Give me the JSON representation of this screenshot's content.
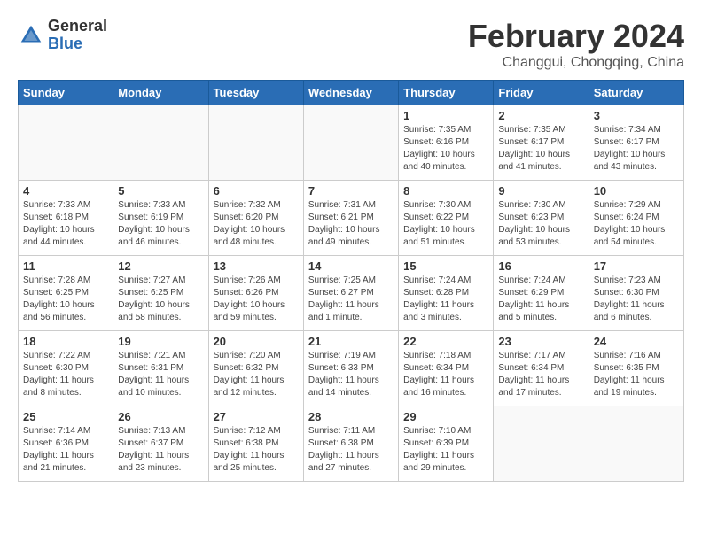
{
  "header": {
    "logo_general": "General",
    "logo_blue": "Blue",
    "title": "February 2024",
    "subtitle": "Changgui, Chongqing, China"
  },
  "days_of_week": [
    "Sunday",
    "Monday",
    "Tuesday",
    "Wednesday",
    "Thursday",
    "Friday",
    "Saturday"
  ],
  "weeks": [
    [
      {
        "day": "",
        "detail": ""
      },
      {
        "day": "",
        "detail": ""
      },
      {
        "day": "",
        "detail": ""
      },
      {
        "day": "",
        "detail": ""
      },
      {
        "day": "1",
        "detail": "Sunrise: 7:35 AM\nSunset: 6:16 PM\nDaylight: 10 hours\nand 40 minutes."
      },
      {
        "day": "2",
        "detail": "Sunrise: 7:35 AM\nSunset: 6:17 PM\nDaylight: 10 hours\nand 41 minutes."
      },
      {
        "day": "3",
        "detail": "Sunrise: 7:34 AM\nSunset: 6:17 PM\nDaylight: 10 hours\nand 43 minutes."
      }
    ],
    [
      {
        "day": "4",
        "detail": "Sunrise: 7:33 AM\nSunset: 6:18 PM\nDaylight: 10 hours\nand 44 minutes."
      },
      {
        "day": "5",
        "detail": "Sunrise: 7:33 AM\nSunset: 6:19 PM\nDaylight: 10 hours\nand 46 minutes."
      },
      {
        "day": "6",
        "detail": "Sunrise: 7:32 AM\nSunset: 6:20 PM\nDaylight: 10 hours\nand 48 minutes."
      },
      {
        "day": "7",
        "detail": "Sunrise: 7:31 AM\nSunset: 6:21 PM\nDaylight: 10 hours\nand 49 minutes."
      },
      {
        "day": "8",
        "detail": "Sunrise: 7:30 AM\nSunset: 6:22 PM\nDaylight: 10 hours\nand 51 minutes."
      },
      {
        "day": "9",
        "detail": "Sunrise: 7:30 AM\nSunset: 6:23 PM\nDaylight: 10 hours\nand 53 minutes."
      },
      {
        "day": "10",
        "detail": "Sunrise: 7:29 AM\nSunset: 6:24 PM\nDaylight: 10 hours\nand 54 minutes."
      }
    ],
    [
      {
        "day": "11",
        "detail": "Sunrise: 7:28 AM\nSunset: 6:25 PM\nDaylight: 10 hours\nand 56 minutes."
      },
      {
        "day": "12",
        "detail": "Sunrise: 7:27 AM\nSunset: 6:25 PM\nDaylight: 10 hours\nand 58 minutes."
      },
      {
        "day": "13",
        "detail": "Sunrise: 7:26 AM\nSunset: 6:26 PM\nDaylight: 10 hours\nand 59 minutes."
      },
      {
        "day": "14",
        "detail": "Sunrise: 7:25 AM\nSunset: 6:27 PM\nDaylight: 11 hours\nand 1 minute."
      },
      {
        "day": "15",
        "detail": "Sunrise: 7:24 AM\nSunset: 6:28 PM\nDaylight: 11 hours\nand 3 minutes."
      },
      {
        "day": "16",
        "detail": "Sunrise: 7:24 AM\nSunset: 6:29 PM\nDaylight: 11 hours\nand 5 minutes."
      },
      {
        "day": "17",
        "detail": "Sunrise: 7:23 AM\nSunset: 6:30 PM\nDaylight: 11 hours\nand 6 minutes."
      }
    ],
    [
      {
        "day": "18",
        "detail": "Sunrise: 7:22 AM\nSunset: 6:30 PM\nDaylight: 11 hours\nand 8 minutes."
      },
      {
        "day": "19",
        "detail": "Sunrise: 7:21 AM\nSunset: 6:31 PM\nDaylight: 11 hours\nand 10 minutes."
      },
      {
        "day": "20",
        "detail": "Sunrise: 7:20 AM\nSunset: 6:32 PM\nDaylight: 11 hours\nand 12 minutes."
      },
      {
        "day": "21",
        "detail": "Sunrise: 7:19 AM\nSunset: 6:33 PM\nDaylight: 11 hours\nand 14 minutes."
      },
      {
        "day": "22",
        "detail": "Sunrise: 7:18 AM\nSunset: 6:34 PM\nDaylight: 11 hours\nand 16 minutes."
      },
      {
        "day": "23",
        "detail": "Sunrise: 7:17 AM\nSunset: 6:34 PM\nDaylight: 11 hours\nand 17 minutes."
      },
      {
        "day": "24",
        "detail": "Sunrise: 7:16 AM\nSunset: 6:35 PM\nDaylight: 11 hours\nand 19 minutes."
      }
    ],
    [
      {
        "day": "25",
        "detail": "Sunrise: 7:14 AM\nSunset: 6:36 PM\nDaylight: 11 hours\nand 21 minutes."
      },
      {
        "day": "26",
        "detail": "Sunrise: 7:13 AM\nSunset: 6:37 PM\nDaylight: 11 hours\nand 23 minutes."
      },
      {
        "day": "27",
        "detail": "Sunrise: 7:12 AM\nSunset: 6:38 PM\nDaylight: 11 hours\nand 25 minutes."
      },
      {
        "day": "28",
        "detail": "Sunrise: 7:11 AM\nSunset: 6:38 PM\nDaylight: 11 hours\nand 27 minutes."
      },
      {
        "day": "29",
        "detail": "Sunrise: 7:10 AM\nSunset: 6:39 PM\nDaylight: 11 hours\nand 29 minutes."
      },
      {
        "day": "",
        "detail": ""
      },
      {
        "day": "",
        "detail": ""
      }
    ]
  ]
}
